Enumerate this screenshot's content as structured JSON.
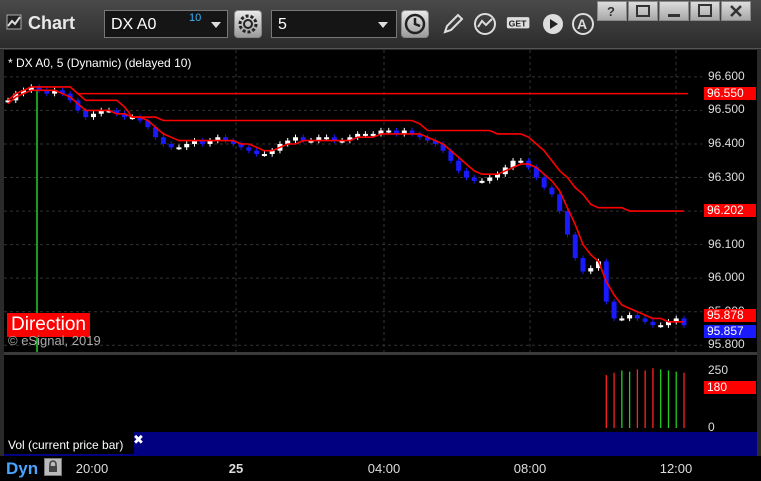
{
  "window": {
    "title": "Chart",
    "symbol": "DX A0",
    "symbol_delay": "10",
    "interval": "5"
  },
  "chart_label": "* DX A0, 5 (Dynamic) (delayed 10)",
  "direction_label": "Direction",
  "copyright": "© eSignal, 2019",
  "volume_label": "Vol (current price bar)",
  "timeline_label": "Dyn",
  "colors": {
    "up_candle": "#ffffff",
    "down_candle": "#1a1aff",
    "red_line": "#ff0000",
    "green_line": "#22cc22",
    "volume_strip": "#000080"
  },
  "chart_data": {
    "type": "candlestick",
    "price_ticks": [
      "96.600",
      "96.500",
      "96.400",
      "96.300",
      "96.200",
      "96.100",
      "96.000",
      "95.900",
      "95.800"
    ],
    "time_ticks": [
      "20:00",
      "25",
      "04:00",
      "08:00",
      "12:00"
    ],
    "price_flags": [
      {
        "value": "96.550",
        "bg": "#ff0000",
        "color": "#ffffff"
      },
      {
        "value": "96.202",
        "bg": "#ff0000",
        "color": "#ffffff"
      },
      {
        "value": "95.878",
        "bg": "#ff0000",
        "color": "#ffffff"
      },
      {
        "value": "95.857",
        "bg": "#1a1aff",
        "color": "#ffffff"
      }
    ],
    "volume_ticks": [
      "250",
      "0"
    ],
    "volume_flag": "180",
    "ylim": [
      95.78,
      96.68
    ],
    "close": [
      96.53,
      96.55,
      96.56,
      96.57,
      96.56,
      96.55,
      96.56,
      96.55,
      96.53,
      96.5,
      96.48,
      96.49,
      96.5,
      96.5,
      96.49,
      96.48,
      96.48,
      96.47,
      96.45,
      96.42,
      96.4,
      96.39,
      96.39,
      96.4,
      96.41,
      96.4,
      96.41,
      96.42,
      96.41,
      96.4,
      96.39,
      96.38,
      96.37,
      96.37,
      96.38,
      96.4,
      96.41,
      96.42,
      96.41,
      96.41,
      96.42,
      96.42,
      96.41,
      96.41,
      96.42,
      96.43,
      96.43,
      96.43,
      96.44,
      96.44,
      96.43,
      96.44,
      96.43,
      96.42,
      96.41,
      96.4,
      96.38,
      96.35,
      96.32,
      96.3,
      96.29,
      96.29,
      96.3,
      96.31,
      96.33,
      96.35,
      96.35,
      96.33,
      96.3,
      96.27,
      96.25,
      96.2,
      96.13,
      96.06,
      96.02,
      96.03,
      96.05,
      95.93,
      95.88,
      95.88,
      95.89,
      95.88,
      95.87,
      95.86,
      95.86,
      95.87,
      95.88,
      95.86
    ],
    "red_short": [
      96.52,
      96.54,
      96.55,
      96.56,
      96.56,
      96.56,
      96.56,
      96.55,
      96.54,
      96.52,
      96.5,
      96.5,
      96.5,
      96.5,
      96.49,
      96.49,
      96.48,
      96.48,
      96.47,
      96.45,
      96.43,
      96.42,
      96.41,
      96.41,
      96.41,
      96.41,
      96.41,
      96.41,
      96.41,
      96.41,
      96.4,
      96.4,
      96.39,
      96.38,
      96.38,
      96.39,
      96.4,
      96.4,
      96.41,
      96.41,
      96.41,
      96.41,
      96.41,
      96.41,
      96.41,
      96.42,
      96.42,
      96.42,
      96.43,
      96.43,
      96.43,
      96.43,
      96.43,
      96.43,
      96.42,
      96.41,
      96.4,
      96.38,
      96.36,
      96.34,
      96.32,
      96.31,
      96.31,
      96.31,
      96.32,
      96.33,
      96.34,
      96.34,
      96.33,
      96.31,
      96.29,
      96.26,
      96.21,
      96.16,
      96.1,
      96.07,
      96.05,
      95.99,
      95.95,
      95.92,
      95.91,
      95.9,
      95.89,
      95.88,
      95.88,
      95.87,
      95.87,
      95.87
    ],
    "red_long": [
      96.53,
      96.55,
      96.56,
      96.57,
      96.57,
      96.57,
      96.57,
      96.57,
      96.57,
      96.55,
      96.53,
      96.53,
      96.53,
      96.53,
      96.53,
      96.51,
      96.48,
      96.48,
      96.48,
      96.48,
      96.47,
      96.47,
      96.47,
      96.47,
      96.47,
      96.47,
      96.47,
      96.47,
      96.47,
      96.47,
      96.47,
      96.47,
      96.47,
      96.47,
      96.47,
      96.47,
      96.47,
      96.47,
      96.47,
      96.47,
      96.47,
      96.47,
      96.47,
      96.47,
      96.47,
      96.47,
      96.47,
      96.47,
      96.47,
      96.47,
      96.47,
      96.47,
      96.47,
      96.46,
      96.44,
      96.44,
      96.44,
      96.44,
      96.44,
      96.44,
      96.44,
      96.44,
      96.44,
      96.43,
      96.43,
      96.43,
      96.43,
      96.42,
      96.4,
      96.38,
      96.35,
      96.32,
      96.3,
      96.27,
      96.25,
      96.22,
      96.21,
      96.21,
      96.21,
      96.21,
      96.2,
      96.2,
      96.2,
      96.2,
      96.2,
      96.2,
      96.2,
      96.2
    ],
    "resistance": 96.55,
    "volume": [
      0,
      0,
      0,
      0,
      0,
      0,
      0,
      0,
      0,
      0,
      0,
      0,
      0,
      0,
      0,
      0,
      0,
      0,
      0,
      0,
      0,
      0,
      0,
      0,
      0,
      0,
      0,
      0,
      0,
      0,
      0,
      0,
      0,
      0,
      0,
      0,
      0,
      0,
      0,
      0,
      0,
      0,
      0,
      0,
      0,
      0,
      0,
      0,
      0,
      0,
      0,
      0,
      0,
      0,
      0,
      0,
      0,
      0,
      0,
      0,
      0,
      0,
      0,
      0,
      0,
      0,
      0,
      0,
      0,
      0,
      0,
      0,
      0,
      0,
      0,
      0,
      0,
      230,
      240,
      250,
      245,
      255,
      250,
      260,
      255,
      250,
      245,
      240
    ],
    "volume_max": 300
  }
}
